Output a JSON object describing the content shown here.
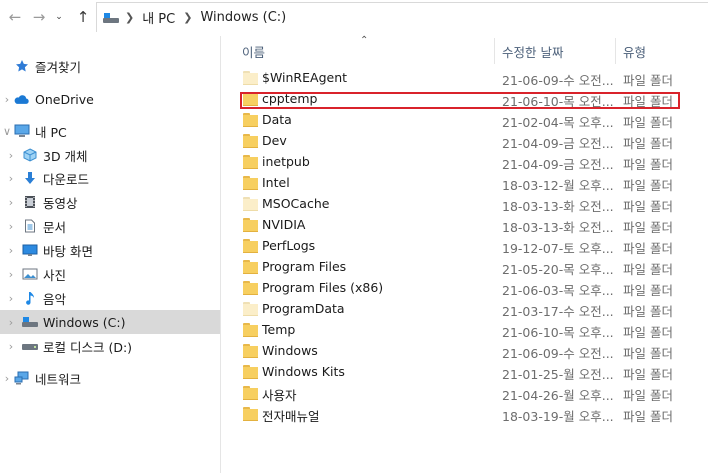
{
  "address_bar": {
    "crumbs": [
      "내 PC",
      "Windows (C:)"
    ]
  },
  "columns": {
    "name": "이름",
    "date": "수정한 날짜",
    "type": "유형"
  },
  "sidebar": {
    "items": [
      {
        "label": "즐겨찾기",
        "icon": "star-icon"
      },
      {
        "label": "OneDrive",
        "icon": "cloud-icon"
      },
      {
        "label": "내 PC",
        "icon": "computer-icon"
      },
      {
        "label": "3D 개체",
        "icon": "cube-icon"
      },
      {
        "label": "다운로드",
        "icon": "download-icon"
      },
      {
        "label": "동영상",
        "icon": "video-icon"
      },
      {
        "label": "문서",
        "icon": "document-icon"
      },
      {
        "label": "바탕 화면",
        "icon": "desktop-icon"
      },
      {
        "label": "사진",
        "icon": "picture-icon"
      },
      {
        "label": "음악",
        "icon": "music-icon"
      },
      {
        "label": "Windows (C:)",
        "icon": "system-drive-icon",
        "selected": true
      },
      {
        "label": "로컬 디스크 (D:)",
        "icon": "disk-icon"
      },
      {
        "label": "네트워크",
        "icon": "network-icon"
      }
    ]
  },
  "files": [
    {
      "name": "$WinREAgent",
      "date": "21-06-09-수 오전...",
      "type": "파일 폴더",
      "hidden": true
    },
    {
      "name": "cpptemp",
      "date": "21-06-10-목 오전...",
      "type": "파일 폴더",
      "hidden": false,
      "highlighted": true
    },
    {
      "name": "Data",
      "date": "21-02-04-목 오후...",
      "type": "파일 폴더",
      "hidden": false
    },
    {
      "name": "Dev",
      "date": "21-04-09-금 오전...",
      "type": "파일 폴더",
      "hidden": false
    },
    {
      "name": "inetpub",
      "date": "21-04-09-금 오전...",
      "type": "파일 폴더",
      "hidden": false
    },
    {
      "name": "Intel",
      "date": "18-03-12-월 오후...",
      "type": "파일 폴더",
      "hidden": false
    },
    {
      "name": "MSOCache",
      "date": "18-03-13-화 오전...",
      "type": "파일 폴더",
      "hidden": true
    },
    {
      "name": "NVIDIA",
      "date": "18-03-13-화 오전...",
      "type": "파일 폴더",
      "hidden": false
    },
    {
      "name": "PerfLogs",
      "date": "19-12-07-토 오후...",
      "type": "파일 폴더",
      "hidden": false
    },
    {
      "name": "Program Files",
      "date": "21-05-20-목 오후...",
      "type": "파일 폴더",
      "hidden": false
    },
    {
      "name": "Program Files (x86)",
      "date": "21-06-03-목 오후...",
      "type": "파일 폴더",
      "hidden": false
    },
    {
      "name": "ProgramData",
      "date": "21-03-17-수 오전...",
      "type": "파일 폴더",
      "hidden": true
    },
    {
      "name": "Temp",
      "date": "21-06-10-목 오후...",
      "type": "파일 폴더",
      "hidden": false
    },
    {
      "name": "Windows",
      "date": "21-06-09-수 오전...",
      "type": "파일 폴더",
      "hidden": false
    },
    {
      "name": "Windows Kits",
      "date": "21-01-25-월 오전...",
      "type": "파일 폴더",
      "hidden": false
    },
    {
      "name": "사용자",
      "date": "21-04-26-월 오후...",
      "type": "파일 폴더",
      "hidden": false
    },
    {
      "name": "전자매뉴얼",
      "date": "18-03-19-월 오후...",
      "type": "파일 폴더",
      "hidden": false
    }
  ],
  "colors": {
    "highlight": "#d9232b",
    "folder": "#f7cf60",
    "selected_nav": "#d9d9d9"
  }
}
